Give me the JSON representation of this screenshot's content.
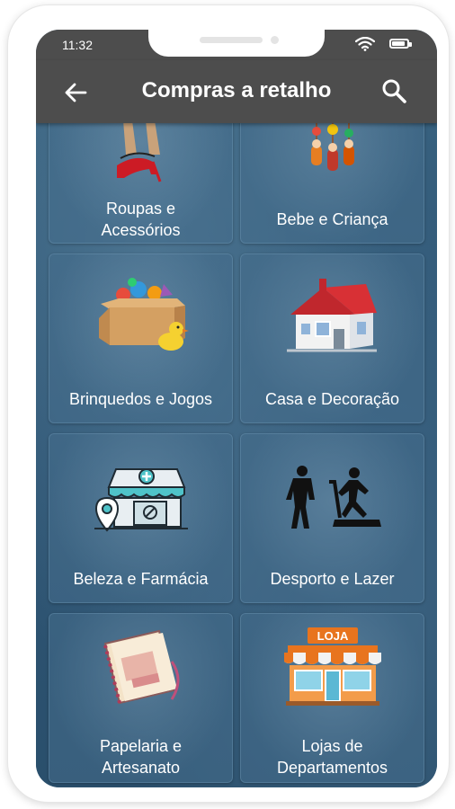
{
  "status": {
    "time": "11:32"
  },
  "appbar": {
    "title": "Compras a retalho"
  },
  "categories": [
    {
      "label": "Roupas e\nAcessórios",
      "icon": "clothing-icon"
    },
    {
      "label": "Bebe e Criança",
      "icon": "baby-toys-icon"
    },
    {
      "label": "Brinquedos e Jogos",
      "icon": "toy-box-icon"
    },
    {
      "label": "Casa e Decoração",
      "icon": "house-icon"
    },
    {
      "label": "Beleza e Farmácia",
      "icon": "pharmacy-store-icon"
    },
    {
      "label": "Desporto e Lazer",
      "icon": "fitness-icon"
    },
    {
      "label": "Papelaria e\nArtesanato",
      "icon": "notebook-icon"
    },
    {
      "label": "Lojas de\nDepartamentos",
      "icon": "shop-icon"
    }
  ],
  "shop_sign": "LOJA"
}
